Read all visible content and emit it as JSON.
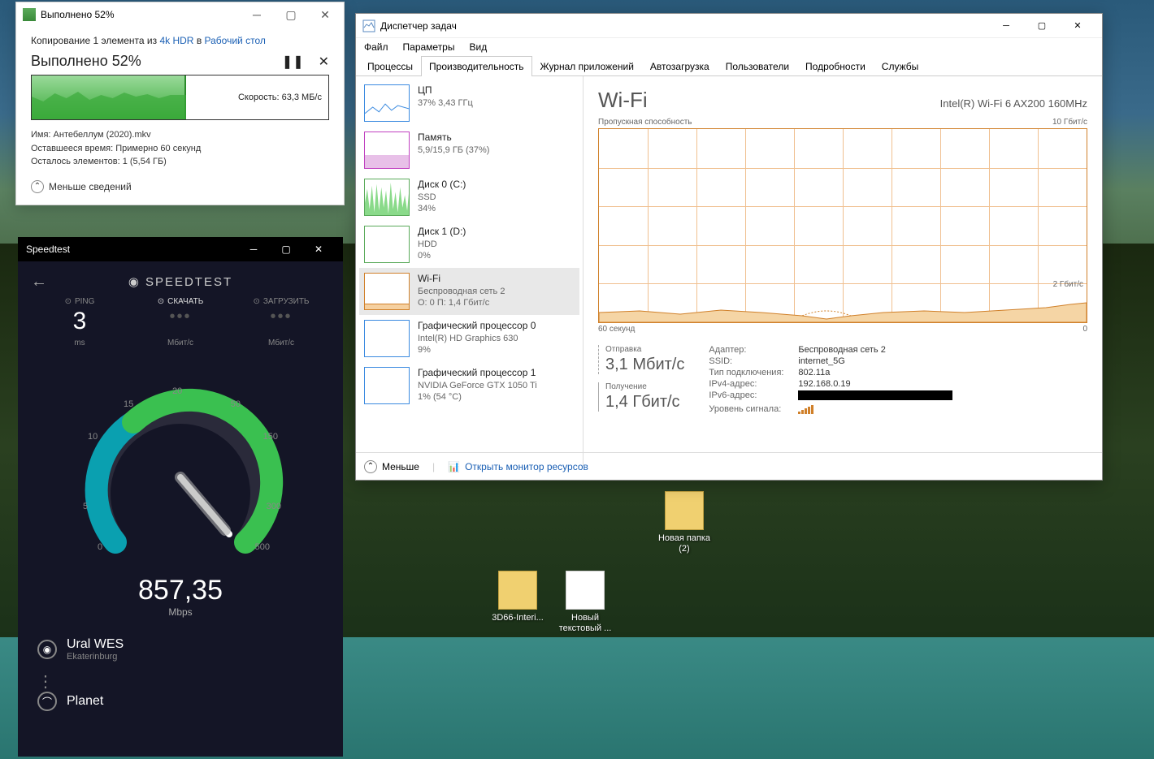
{
  "desktop_icons": [
    {
      "name": "3D66-Interi...",
      "type": "folder"
    },
    {
      "name": "Новый текстовый ...",
      "type": "doc"
    },
    {
      "name": "Новая папка (2)",
      "type": "folder"
    }
  ],
  "copy": {
    "title": "Выполнено 52%",
    "desc_pre": "Копирование 1 элемента из ",
    "link1": "4k HDR",
    "desc_mid": " в ",
    "link2": "Рабочий стол",
    "progress": "Выполнено 52%",
    "speed": "Скорость: 63,3 МБ/с",
    "name_lbl": "Имя: ",
    "name": "Антебеллум (2020).mkv",
    "time_lbl": "Оставшееся время: ",
    "time": "Примерно 60 секунд",
    "remain_lbl": "Осталось элементов: ",
    "remain": "1 (5,54 ГБ)",
    "less": "Меньше сведений",
    "percent": 52
  },
  "speedtest": {
    "title": "Speedtest",
    "logo": "SPEEDTEST",
    "ping_lbl": "PING",
    "download_lbl": "СКАЧАТЬ",
    "upload_lbl": "ЗАГРУЗИТЬ",
    "ping_val": "3",
    "ping_unit": "ms",
    "dl_unit": "Мбит/с",
    "ul_unit": "Мбит/с",
    "gauge_val": "857,35",
    "gauge_unit": "Mbps",
    "gauge_nums": {
      "0": "0",
      "5": "5",
      "10": "10",
      "15": "15",
      "20": "20",
      "50": "50",
      "150": "150",
      "300": "300",
      "500": "500"
    },
    "isp": "Ural WES",
    "city": "Ekaterinburg",
    "server": "Planet"
  },
  "tm": {
    "title": "Диспетчер задач",
    "menu": [
      "Файл",
      "Параметры",
      "Вид"
    ],
    "tabs": [
      "Процессы",
      "Производительность",
      "Журнал приложений",
      "Автозагрузка",
      "Пользователи",
      "Подробности",
      "Службы"
    ],
    "active_tab": 1,
    "side": [
      {
        "id": "cpu",
        "title": "ЦП",
        "sub": "37% 3,43 ГГц"
      },
      {
        "id": "mem",
        "title": "Память",
        "sub": "5,9/15,9 ГБ (37%)"
      },
      {
        "id": "disk0",
        "title": "Диск 0 (C:)",
        "sub": "SSD\n34%"
      },
      {
        "id": "disk1",
        "title": "Диск 1 (D:)",
        "sub": "HDD\n0%"
      },
      {
        "id": "wifi",
        "title": "Wi-Fi",
        "sub": "Беспроводная сеть 2\nО: 0 П: 1,4 Гбит/с"
      },
      {
        "id": "gpu0",
        "title": "Графический процессор 0",
        "sub": "Intel(R) HD Graphics 630\n9%"
      },
      {
        "id": "gpu1",
        "title": "Графический процессор 1",
        "sub": "NVIDIA GeForce GTX 1050 Ti\n1% (54 °C)"
      }
    ],
    "selected": 4,
    "main": {
      "heading": "Wi-Fi",
      "adapter": "Intel(R) Wi-Fi 6 AX200 160MHz",
      "chart_label": "Пропускная способность",
      "chart_max": "10 Гбит/с",
      "chart_mid": "2 Гбит/с",
      "x_left": "60 секунд",
      "x_right": "0",
      "send_lbl": "Отправка",
      "send_val": "3,1 Мбит/с",
      "recv_lbl": "Получение",
      "recv_val": "1,4 Гбит/с",
      "details": {
        "adapter_lbl": "Адаптер:",
        "adapter": "Беспроводная сеть 2",
        "ssid_lbl": "SSID:",
        "ssid": "internet_5G",
        "type_lbl": "Тип подключения:",
        "type": "802.11a",
        "ipv4_lbl": "IPv4-адрес:",
        "ipv4": "192.168.0.19",
        "ipv6_lbl": "IPv6-адрес:",
        "signal_lbl": "Уровень сигнала:"
      }
    },
    "footer": {
      "less": "Меньше",
      "resmon": "Открыть монитор ресурсов"
    }
  },
  "chart_data": {
    "type": "line",
    "title": "Wi-Fi Пропускная способность",
    "x": [
      0,
      5,
      10,
      15,
      20,
      25,
      30,
      35,
      40,
      45,
      50,
      55,
      60
    ],
    "series": [
      {
        "name": "Получение",
        "values": [
          1.4,
          1.4,
          1.45,
          1.5,
          1.5,
          1.45,
          1.4,
          1.5,
          1.5,
          1.5,
          1.55,
          1.6,
          1.8
        ]
      },
      {
        "name": "Отправка",
        "values": [
          0.003,
          0.003,
          0.003,
          0.003,
          0.003,
          0.003,
          0.003,
          0.003,
          0.003,
          0.003,
          0.003,
          0.003,
          0.003
        ]
      }
    ],
    "ylim": [
      0,
      10
    ],
    "ylabel": "Гбит/с",
    "xlabel": "секунд"
  }
}
